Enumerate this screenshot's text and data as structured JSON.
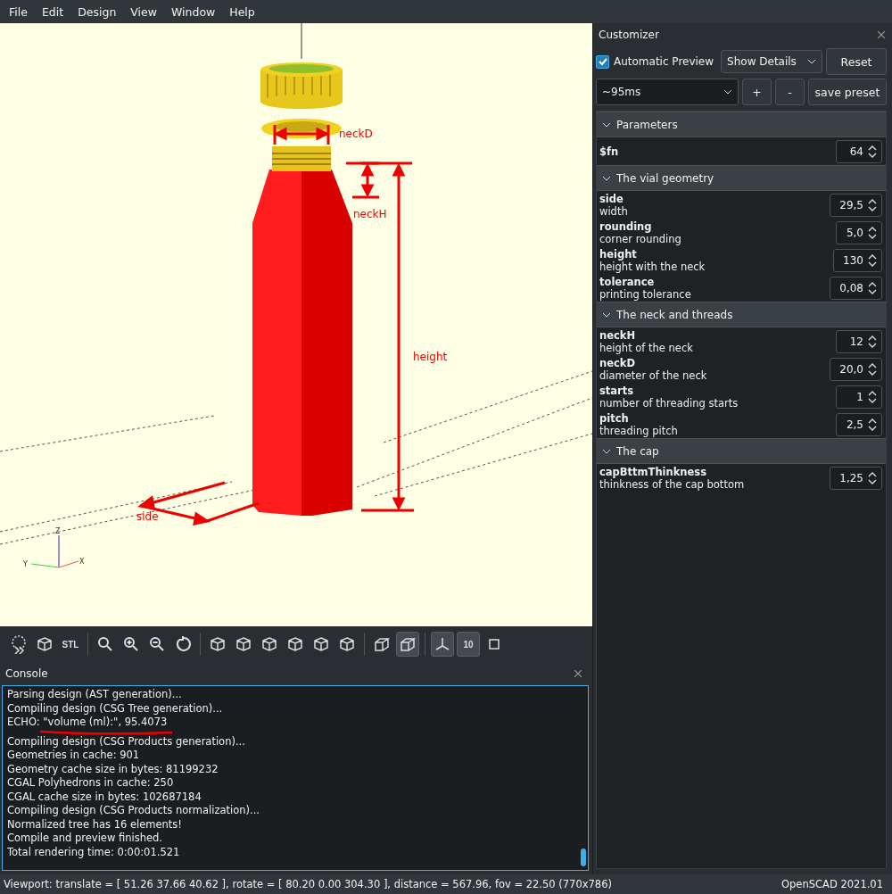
{
  "menu": [
    "File",
    "Edit",
    "Design",
    "View",
    "Window",
    "Help"
  ],
  "viewport": {
    "labels": [
      {
        "kind": "neckD",
        "text": "neckD"
      },
      {
        "kind": "neckH",
        "text": "neckH"
      },
      {
        "kind": "height",
        "text": "height"
      },
      {
        "kind": "side",
        "text": "side"
      }
    ],
    "axes": {
      "x": "X",
      "y": "Y",
      "z": "Z"
    }
  },
  "toolbar": [
    [
      {
        "kind": "render"
      },
      {
        "kind": "view3d"
      },
      {
        "kind": "stl",
        "label": "STL"
      }
    ],
    [
      {
        "kind": "zoomall"
      },
      {
        "kind": "zoomin"
      },
      {
        "kind": "zoomout"
      },
      {
        "kind": "reset"
      }
    ],
    [
      {
        "kind": "cube"
      },
      {
        "kind": "cube"
      },
      {
        "kind": "cube"
      },
      {
        "kind": "cube"
      },
      {
        "kind": "cube"
      },
      {
        "kind": "cube"
      }
    ],
    [
      {
        "kind": "perspective",
        "pressed": false
      },
      {
        "kind": "ortho",
        "pressed": true
      }
    ],
    [
      {
        "kind": "axes",
        "pressed": true
      },
      {
        "kind": "scale",
        "pressed": true,
        "label": "10"
      },
      {
        "kind": "crosshair",
        "pressed": false
      }
    ]
  ],
  "console": {
    "title": "Console",
    "lines": [
      {
        "text": "Parsing design (AST generation)...",
        "underlined": false
      },
      {
        "text": "Compiling design (CSG Tree generation)...",
        "underlined": false
      },
      {
        "text": "ECHO: \"volume (ml):\", 95.4073",
        "underlined": true
      },
      {
        "text": "Compiling design (CSG Products generation)...",
        "underlined": false
      },
      {
        "text": "Geometries in cache: 901",
        "underlined": false
      },
      {
        "text": "Geometry cache size in bytes: 81199232",
        "underlined": false
      },
      {
        "text": "CGAL Polyhedrons in cache: 250",
        "underlined": false
      },
      {
        "text": "CGAL cache size in bytes: 102687184",
        "underlined": false
      },
      {
        "text": "Compiling design (CSG Products normalization)...",
        "underlined": false
      },
      {
        "text": "Normalized tree has 16 elements!",
        "underlined": false
      },
      {
        "text": "Compile and preview finished.",
        "underlined": false
      },
      {
        "text": "Total rendering time: 0:00:01.521",
        "underlined": false
      }
    ]
  },
  "customizer": {
    "title": "Customizer",
    "automatic_preview": {
      "label": "Automatic Preview",
      "checked": true
    },
    "details_dropdown": "Show Details",
    "reset_button": "Reset",
    "preset_dropdown": "~95ms",
    "add_button": "+",
    "remove_button": "-",
    "save_button": "save preset",
    "groups": [
      {
        "title": "Parameters",
        "expanded": true,
        "params": [
          {
            "name": "$fn",
            "value": "64"
          }
        ]
      },
      {
        "title": "The vial geometry",
        "expanded": true,
        "params": [
          {
            "name": "side",
            "description": "width",
            "value": "29,5"
          },
          {
            "name": "rounding",
            "description": "corner rounding",
            "value": "5,0"
          },
          {
            "name": "height",
            "description": "height with the neck",
            "value": "130"
          },
          {
            "name": "tolerance",
            "description": "printing tolerance",
            "value": "0,08"
          }
        ]
      },
      {
        "title": "The neck and threads",
        "expanded": true,
        "params": [
          {
            "name": "neckH",
            "description": "height of the neck",
            "value": "12"
          },
          {
            "name": "neckD",
            "description": "diameter of the neck",
            "value": "20,0"
          },
          {
            "name": "starts",
            "description": "number of threading starts",
            "value": "1"
          },
          {
            "name": "pitch",
            "description": "threading pitch",
            "value": "2,5"
          }
        ]
      },
      {
        "title": "The cap",
        "expanded": true,
        "params": [
          {
            "name": "capBttmThinkness",
            "description": "thinkness of the cap bottom",
            "value": "1,25"
          }
        ]
      }
    ]
  },
  "status_bar": {
    "viewport": "Viewport: translate = [ 51.26 37.66 40.62 ], rotate = [ 80.20 0.00 304.30 ], distance = 567.96, fov = 22.50 (770x786)",
    "version": "OpenSCAD 2021.01"
  }
}
